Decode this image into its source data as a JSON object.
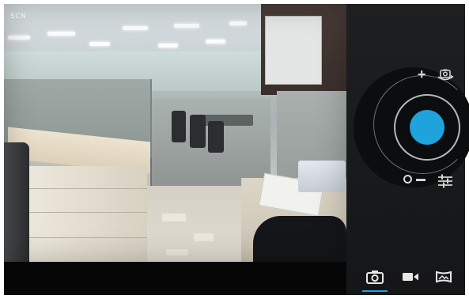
{
  "viewfinder": {
    "scene_mode_label": "SCN"
  },
  "controls": {
    "zoom_in_symbol": "+",
    "shutter_color": "#1ea3dd",
    "icons": [
      "switch-camera-icon",
      "settings-sliders-icon",
      "zoom-slider"
    ],
    "accent_color": "#1ea3dd"
  },
  "modes": {
    "items": [
      "photo-mode-icon",
      "video-mode-icon",
      "panorama-mode-icon"
    ],
    "selected": "photo"
  }
}
